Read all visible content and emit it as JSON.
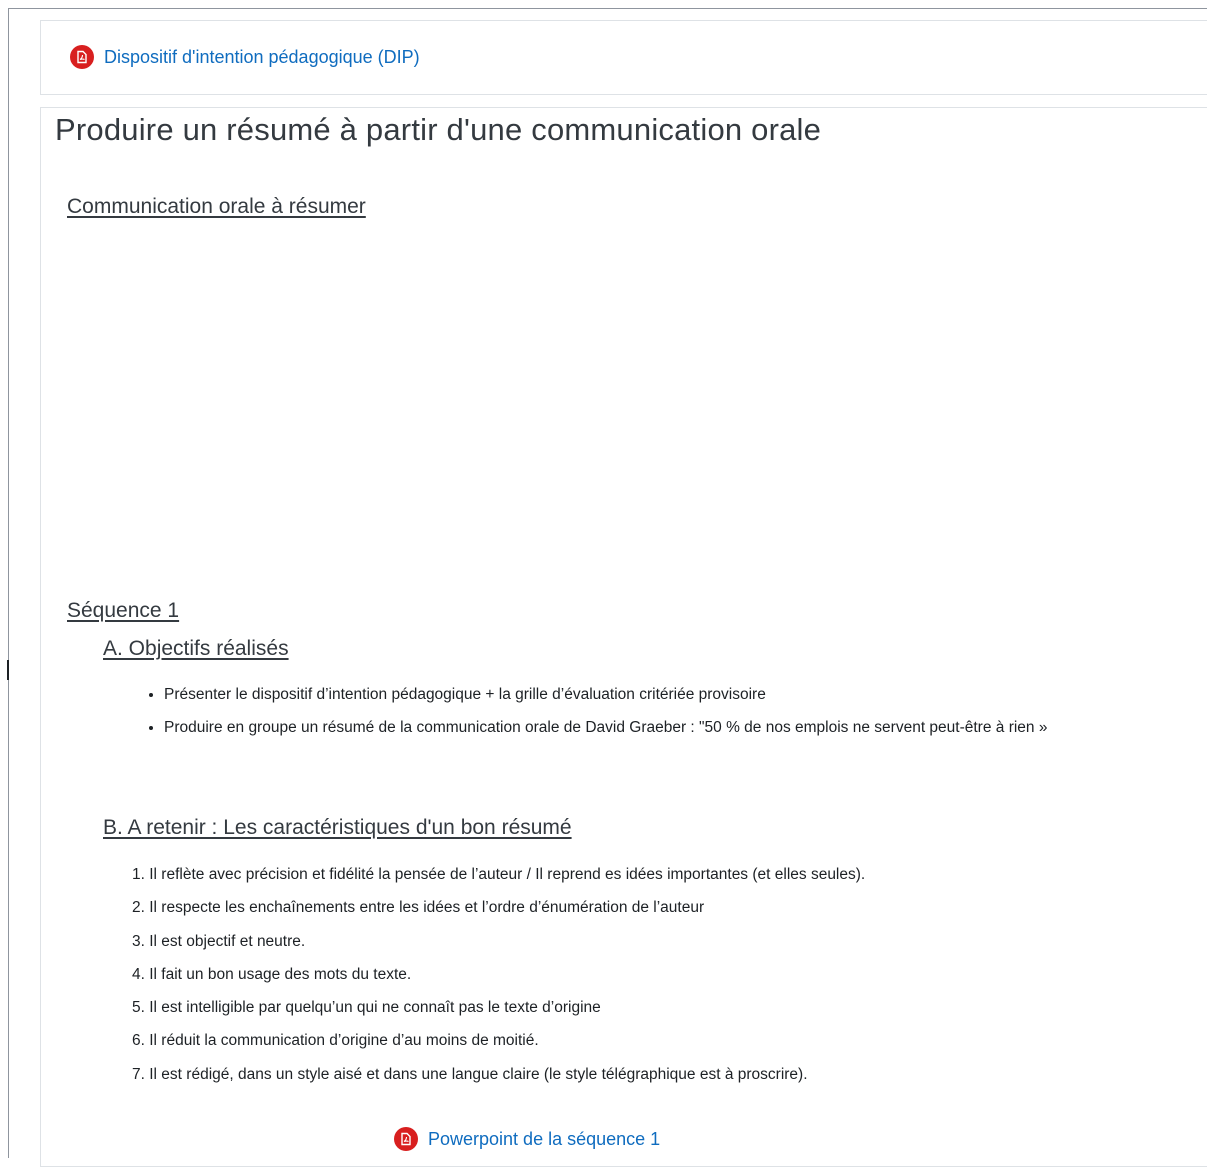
{
  "dip_link": {
    "label": "Dispositif d'intention pédagogique (DIP)",
    "icon": "pdf-icon",
    "icon_color": "#d81f1f"
  },
  "page_title": "Produire un résumé à partir d'une communication orale",
  "communication_heading": "Communication orale à résumer",
  "sequence": {
    "heading": "Séquence 1",
    "objectives": {
      "heading": "A. Objectifs réalisés",
      "items": [
        "Présenter le dispositif d’intention pédagogique + la grille d’évaluation critériée provisoire",
        "Produire en groupe un résumé de la communication orale de David Graeber : \"50 % de nos emplois ne servent peut-être à rien »"
      ]
    },
    "retain": {
      "heading": "B. A retenir : Les caractéristiques d'un bon résumé",
      "items": [
        {
          "num": "1.",
          "text": "Il reflète avec précision et fidélité la pensée de l’auteur / Il reprend es idées importantes (et elles seules)."
        },
        {
          "num": "2.",
          "text": "Il respecte les enchaînements entre les idées et l’ordre d’énumération de l’auteur"
        },
        {
          "num": "3.",
          "text": "Il est objectif et neutre."
        },
        {
          "num": "4.",
          "text": "Il fait un bon usage des mots du texte."
        },
        {
          "num": "5.",
          "text": "Il est intelligible par quelqu’un qui ne connaît pas le texte d’origine"
        },
        {
          "num": "6.",
          "text": "Il réduit la communication d’origine d’au moins de moitié."
        },
        {
          "num": "7.",
          "text": "Il est rédigé, dans un style aisé et dans une langue claire (le style télégraphique est à proscrire)."
        }
      ]
    },
    "powerpoint_link": {
      "label": "Powerpoint de la séquence 1",
      "icon": "pdf-icon"
    }
  },
  "colors": {
    "link": "#0f6cbf",
    "heading": "#343a40",
    "text": "#1d2125"
  }
}
